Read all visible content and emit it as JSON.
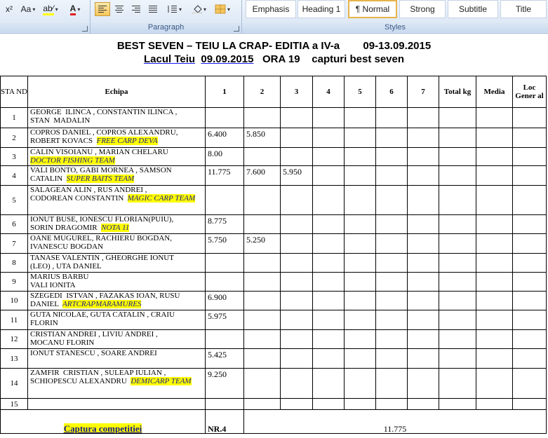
{
  "ribbon": {
    "font_group_label": "",
    "paragraph_group_label": "Paragraph",
    "styles_group_label": "Styles",
    "font_tools": [
      "x²",
      "Aa",
      "ab⁄",
      "A"
    ],
    "styles": [
      "Emphasis",
      "Heading 1",
      "¶ Normal",
      "Strong",
      "Subtitle",
      "Title"
    ],
    "selected_style": "¶ Normal"
  },
  "document": {
    "title_line1": "BEST SEVEN – TEIU LA CRAP- EDITIA a IV-a        09-13.09.2015",
    "title_line2a": "Lacul Teiu",
    "title_line2b": "09.09.2015",
    "title_line2c": "ORA 19",
    "title_line2d": "capturi best seven",
    "headers": {
      "stand": "STA ND",
      "echipa": "Echipa",
      "c1": "1",
      "c2": "2",
      "c3": "3",
      "c4": "4",
      "c5": "5",
      "c6": "6",
      "c7": "7",
      "total": "Total kg",
      "media": "Media",
      "loc": "Loc Gener al"
    },
    "rows": [
      {
        "stand": "1",
        "team": "GEORGE  ILINCA , CONSTANTIN ILINCA ,\nSTAN  MADALIN",
        "club": "",
        "v1": "",
        "v2": "",
        "v3": ""
      },
      {
        "stand": "2",
        "team": "COPROS DANIEL , COPROS ALEXANDRU,\nROBERT KOVACS",
        "club": "FREE CARP DEVA",
        "v1": "6.400",
        "v2": "5.850",
        "v3": ""
      },
      {
        "stand": "3",
        "team": "CALIN VISOIANU , MARIAN CHELARU",
        "club": "DOCTOR FISHING TEAM",
        "v1": "8.00",
        "v2": "",
        "v3": ""
      },
      {
        "stand": "4",
        "team": "VALI BONTO, GABI MORNEA , SAMSON\nCATALIN",
        "club": "SUPER BAITS TEAM",
        "v1": "11.775",
        "v2": "7.600",
        "v3": "5.950"
      },
      {
        "stand": "5",
        "team": "SALAGEAN ALIN , RUS ANDREI ,\nCODOREAN CONSTANTIN",
        "club": "MAGIC CARP TEAM",
        "v1": "",
        "v2": "",
        "v3": ""
      },
      {
        "stand": "6",
        "team": "IONUT BUSE, IONESCU FLORIAN(PUIU),\nSORIN DRAGOMIR",
        "club": "NOTA 11",
        "v1": "8.775",
        "v2": "",
        "v3": ""
      },
      {
        "stand": "7",
        "team": "OANE MUGUREL, RACHIERU BOGDAN,\nIVANESCU BOGDAN",
        "club": "",
        "v1": "5.750",
        "v2": "5.250",
        "v3": ""
      },
      {
        "stand": "8",
        "team": "TANASE VALENTIN , GHEORGHE IONUT\n(LEO) , UTA DANIEL",
        "club": "",
        "v1": "",
        "v2": "",
        "v3": ""
      },
      {
        "stand": "9",
        "team": "MARIUS BARBU\nVALI IONITA",
        "club": "",
        "v1": "",
        "v2": "",
        "v3": ""
      },
      {
        "stand": "10",
        "team": "SZEGEDI  ISTVAN , FAZAKAS IOAN, RUSU\nDANIEL",
        "club": "ARTCRAPMARAMURES",
        "v1": "6.900",
        "v2": "",
        "v3": ""
      },
      {
        "stand": "11",
        "team": "GUTA NICOLAE, GUTA CATALIN , CRAIU\nFLORIN",
        "club": "",
        "v1": "5.975",
        "v2": "",
        "v3": ""
      },
      {
        "stand": "12",
        "team": "CRISTIAN ANDREI , LIVIU ANDREI ,\nMOCANU FLORIN",
        "club": "",
        "v1": "",
        "v2": "",
        "v3": ""
      },
      {
        "stand": "13",
        "team": "IONUT STANESCU , SOARE ANDREI",
        "club": "",
        "v1": "5.425",
        "v2": "",
        "v3": ""
      },
      {
        "stand": "14",
        "team": "ZAMFIR  CRISTIAN , SULEAP IULIAN ,\nSCHIOPESCU ALEXANDRU",
        "club": "DEMICARP TEAM",
        "v1": "9.250",
        "v2": "",
        "v3": ""
      },
      {
        "stand": "15",
        "team": "",
        "club": "",
        "v1": "",
        "v2": "",
        "v3": ""
      }
    ],
    "footer": {
      "label": "Captura competitiei",
      "nr": "NR.4",
      "value": "11.775"
    }
  }
}
